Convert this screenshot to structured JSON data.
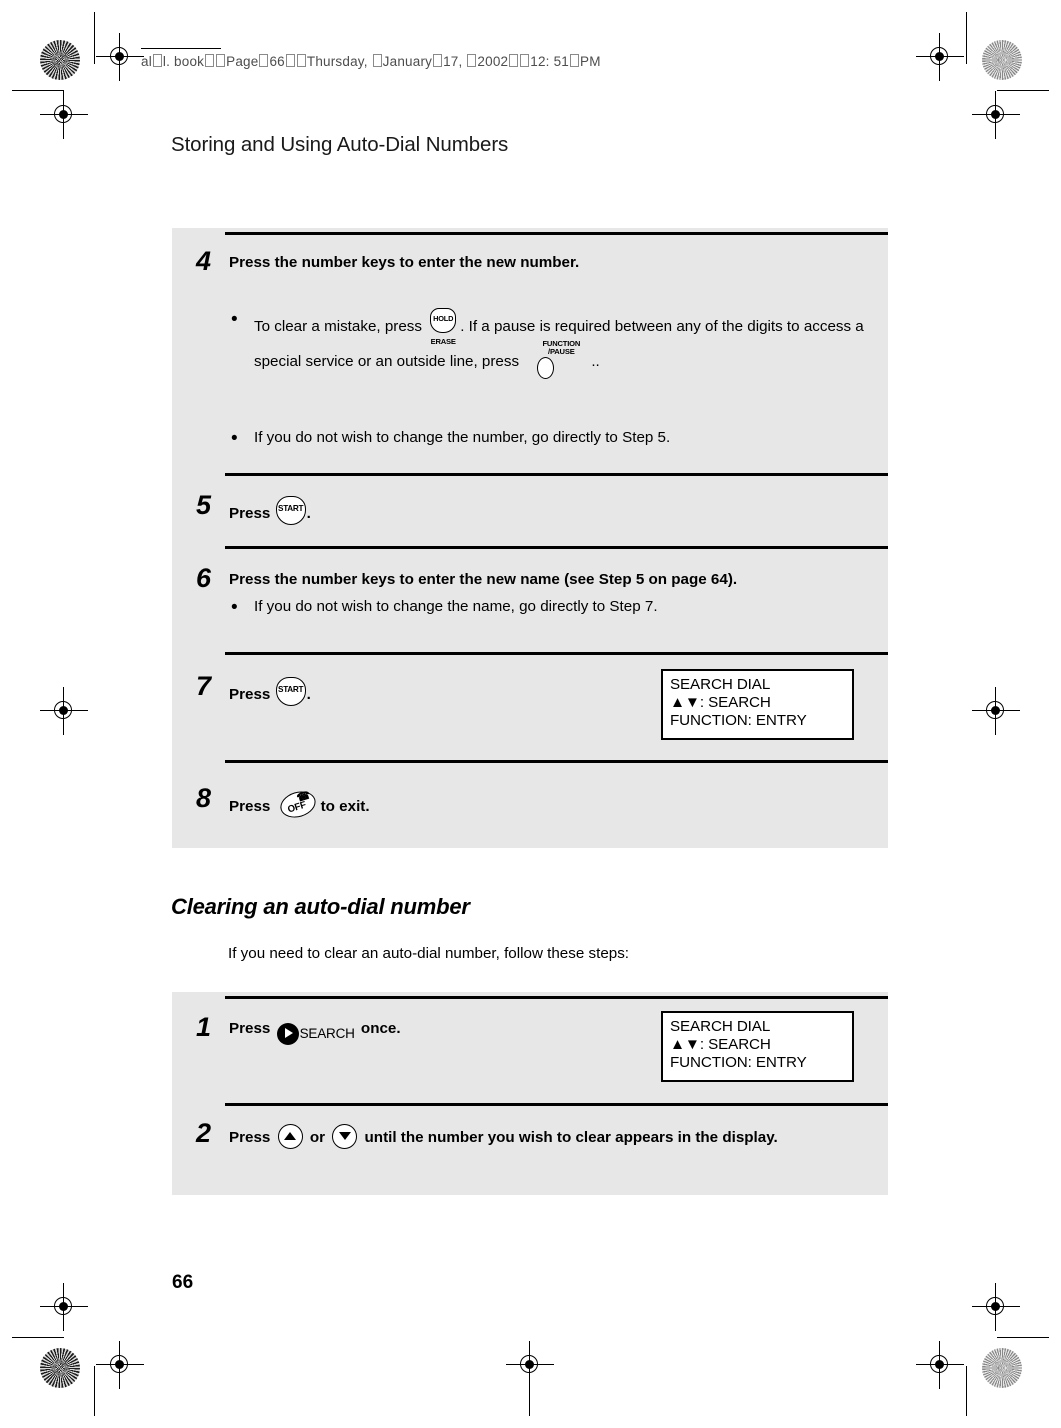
{
  "running_header": {
    "parts": [
      "al",
      "l",
      ". book",
      "Page",
      "66",
      "Thursday, ",
      "J",
      "anuary",
      "17, ",
      "2002",
      "12: 51",
      "PM"
    ],
    "text": "all.book  Page 66  Thursday, January 17, 2002  12:51 PM"
  },
  "page_title": "Storing and Using Auto-Dial Numbers",
  "folio": "66",
  "section1": {
    "steps": [
      {
        "number": "4",
        "text": "Press the number keys to enter the new number.",
        "bullets": [
          {
            "before": "To clear a mistake, press",
            "icon": "hold-erase-button",
            "icon_label": "HOLD",
            "icon_sublabel": "ERASE",
            "middle": ". If a pause is required between any of the digits to access a special service or an outside line, press",
            "icon2": "function-pause-button",
            "icon2_label": "FUNCTION",
            "icon2_sublabel": "/PAUSE",
            "after": ".."
          },
          {
            "before": "If you do not wish to change the number, go directly to Step 5.",
            "icon": "",
            "middle": "",
            "after": ""
          }
        ]
      },
      {
        "number": "5",
        "text_before": "Press",
        "icon": "start-button",
        "icon_label": "START",
        "text_after": "."
      },
      {
        "number": "6",
        "text": "Press the number keys to enter the new name (see Step 5 on page 64).",
        "bullets": [
          {
            "before": "If you do not wish to change the name, go directly to Step 7."
          }
        ]
      },
      {
        "number": "7",
        "text_before": "Press",
        "icon": "start-button",
        "icon_label": "START",
        "text_after": ".",
        "display": {
          "line1": "SEARCH DIAL",
          "line2": "▲▼: SEARCH",
          "line3": "FUNCTION: ENTRY"
        }
      },
      {
        "number": "8",
        "text_before": "Press",
        "icon": "off-button",
        "icon_label": "OFF",
        "text_after": "to exit."
      }
    ]
  },
  "section2": {
    "heading": "Clearing an auto-dial number",
    "intro": "If you need to clear an auto-dial number, follow these steps:",
    "steps": [
      {
        "number": "1",
        "text_before": "Press",
        "icon": "search-button",
        "icon_label": "SEARCH",
        "text_after": "once.",
        "display": {
          "line1": "SEARCH DIAL",
          "line2": "▲▼: SEARCH",
          "line3": "FUNCTION: ENTRY"
        }
      },
      {
        "number": "2",
        "text_before": "Press",
        "icon_up": "up-arrow-button",
        "text_mid": "or",
        "icon_down": "down-arrow-button",
        "text_after": "until the number you wish to clear appears in the display."
      }
    ]
  },
  "colors": {
    "panel_bg": "#e7e7e7",
    "rule": "#000000",
    "page_bg": "#ffffff",
    "header_text": "#4d4d4d"
  }
}
